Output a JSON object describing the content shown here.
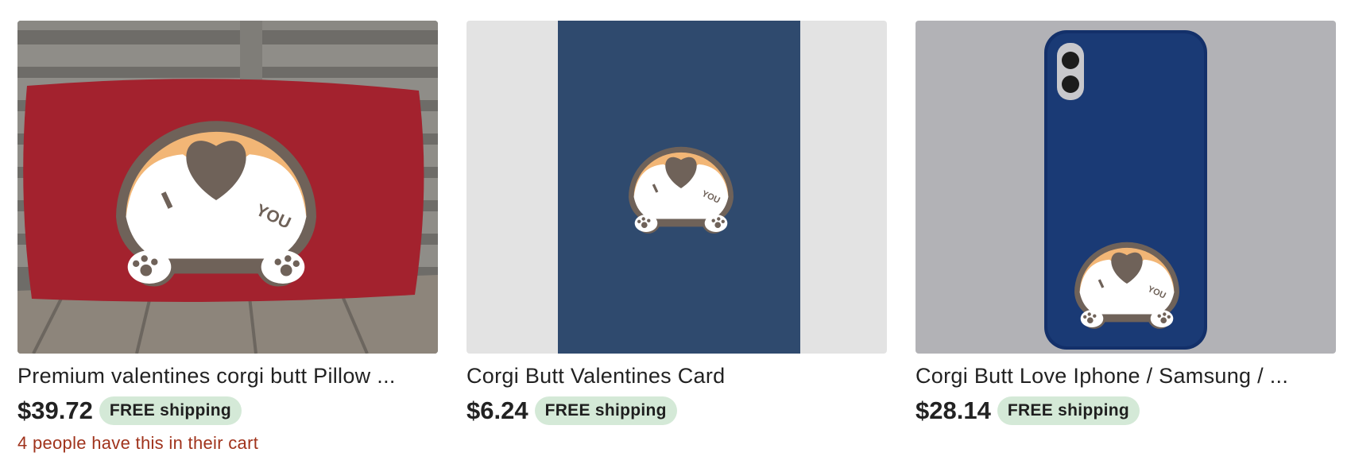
{
  "listings": [
    {
      "title": "Premium valentines corgi butt Pillow ...",
      "price": "$39.72",
      "shipping_badge": "FREE shipping",
      "cart_note": "4 people have this in their cart",
      "image_icon": "corgi-butt-pillow-photo",
      "colors": {
        "pillow": "#a3222e",
        "background": "#6e6c68"
      }
    },
    {
      "title": "Corgi Butt Valentines Card",
      "price": "$6.24",
      "shipping_badge": "FREE shipping",
      "cart_note": "",
      "image_icon": "corgi-butt-card-photo",
      "colors": {
        "card": "#2f4a6e",
        "background": "#e3e3e3"
      }
    },
    {
      "title": "Corgi Butt Love Iphone / Samsung / ...",
      "price": "$28.14",
      "shipping_badge": "FREE shipping",
      "cart_note": "",
      "image_icon": "corgi-butt-phone-case-photo",
      "colors": {
        "case": "#1a3a75",
        "background": "#b2b2b6"
      }
    }
  ],
  "colors": {
    "free_shipping_bg": "#d4e9d7",
    "cart_note_text": "#a0331c"
  }
}
